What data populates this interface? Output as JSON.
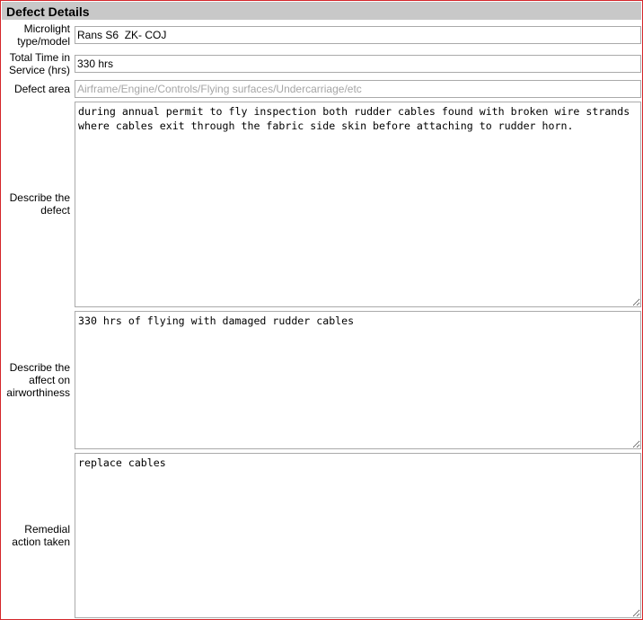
{
  "section": {
    "title": "Defect Details"
  },
  "fields": {
    "microlight_type": {
      "label": "Microlight type/model",
      "value": "Rans S6  ZK- COJ"
    },
    "total_time": {
      "label": "Total Time in Service (hrs)",
      "value": "330 hrs"
    },
    "defect_area": {
      "label": "Defect area",
      "value": "",
      "placeholder": "Airframe/Engine/Controls/Flying surfaces/Undercarriage/etc"
    },
    "describe_defect": {
      "label": "Describe the defect",
      "value": "during annual permit to fly inspection both rudder cables found with broken wire strands where cables exit through the fabric side skin before attaching to rudder horn."
    },
    "airworthiness_effect": {
      "label": "Describe the affect on airworthiness",
      "value": "330 hrs of flying with damaged rudder cables"
    },
    "remedial_action": {
      "label": "Remedial action taken",
      "value": "replace cables"
    }
  },
  "colors": {
    "panel_border": "#d4262b",
    "header_background": "#c8c8c8",
    "field_border": "#aaaaaa",
    "placeholder_text": "#a6a6a6"
  }
}
